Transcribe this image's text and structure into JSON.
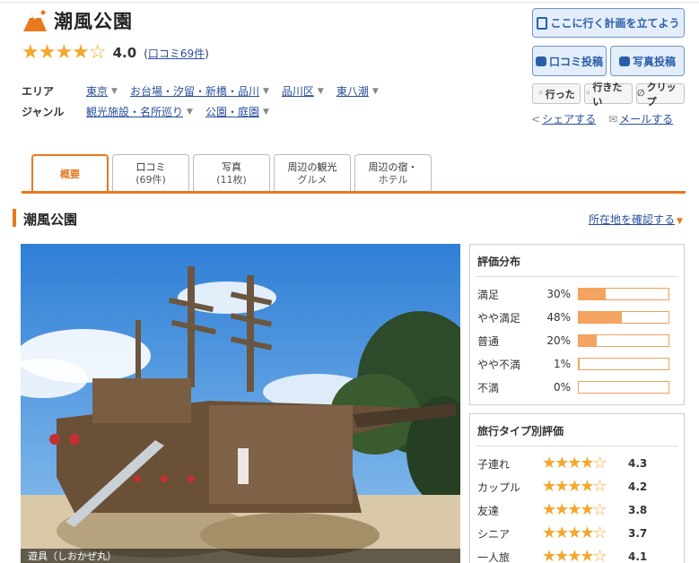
{
  "spot": {
    "title": "潮風公園",
    "rating_value": "4.0",
    "rating_stars": "★★★★",
    "rating_empty": "☆",
    "review_link": "口コミ69件",
    "colors": {
      "accent": "#e8791f",
      "link": "#2a4f9e",
      "star": "#f2a82f",
      "button_blue": "#2a5fa8"
    }
  },
  "meta": {
    "area_label": "エリア",
    "areas": [
      "東京",
      "お台場・汐留・新橋・品川",
      "品川区",
      "東八潮"
    ],
    "genre_label": "ジャンル",
    "genres": [
      "観光施設・名所巡り",
      "公園・庭園"
    ]
  },
  "actions": {
    "plan": "ここに行く計画を立てよう",
    "review_post": "口コミ投稿",
    "photo_post": "写真投稿",
    "went": "行った",
    "want": "行きたい",
    "clip": "クリップ",
    "share": "シェアする",
    "mail": "メールする"
  },
  "tabs": [
    {
      "label": "概要",
      "sub": ""
    },
    {
      "label": "口コミ",
      "sub": "(69件)"
    },
    {
      "label": "写真",
      "sub": "(11枚)"
    },
    {
      "label": "周辺の観光",
      "sub": "グルメ"
    },
    {
      "label": "周辺の宿・",
      "sub": "ホテル"
    }
  ],
  "section": {
    "title": "潮風公園",
    "location_link": "所在地を確認する"
  },
  "photo": {
    "caption": "遊具（しおかぜ丸）"
  },
  "distribution": {
    "title": "評価分布",
    "rows": [
      {
        "label": "満足",
        "pct": "30%",
        "value": 0.3
      },
      {
        "label": "やや満足",
        "pct": "48%",
        "value": 0.48
      },
      {
        "label": "普通",
        "pct": "20%",
        "value": 0.2
      },
      {
        "label": "やや不満",
        "pct": "1%",
        "value": 0.01
      },
      {
        "label": "不満",
        "pct": "0%",
        "value": 0.0
      }
    ]
  },
  "travel_type": {
    "title": "旅行タイプ別評価",
    "rows": [
      {
        "label": "子連れ",
        "stars": "★★★★☆",
        "score": "4.3"
      },
      {
        "label": "カップル",
        "stars": "★★★★☆",
        "score": "4.2"
      },
      {
        "label": "友達",
        "stars": "★★★★☆",
        "score": "3.8"
      },
      {
        "label": "シニア",
        "stars": "★★★★☆",
        "score": "3.7"
      },
      {
        "label": "一人旅",
        "stars": "★★★★☆",
        "score": "4.1"
      }
    ]
  }
}
